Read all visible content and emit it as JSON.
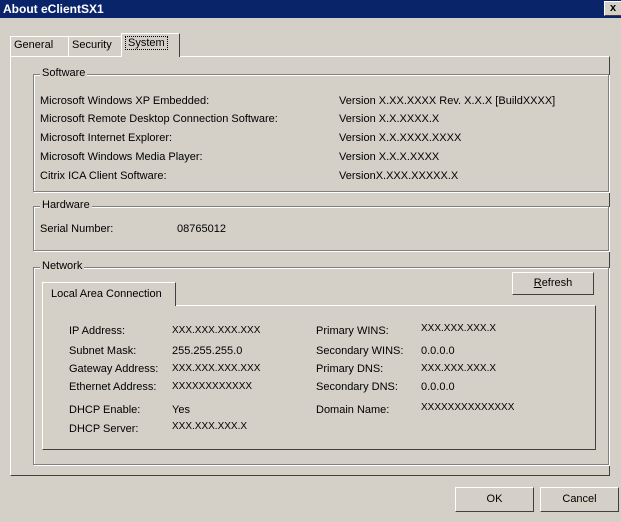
{
  "window": {
    "title": "About eClientSX1",
    "close_glyph": "x"
  },
  "tabs": [
    "General",
    "Security",
    "System"
  ],
  "software": {
    "title": "Software",
    "rows": [
      {
        "label": "Microsoft Windows XP Embedded:",
        "value": "Version X.XX.XXXX Rev. X.X.X [BuildXXXX]"
      },
      {
        "label": "Microsoft Remote Desktop Connection Software:",
        "value": "Version X.X.XXXX.X"
      },
      {
        "label": "Microsoft Internet Explorer:",
        "value": "Version X.X.XXXX.XXXX"
      },
      {
        "label": "Microsoft Windows Media Player:",
        "value": "Version X.X.X.XXXX"
      },
      {
        "label": "Citrix ICA Client Software:",
        "value": "VersionX.XXX.XXXXX.X"
      }
    ]
  },
  "hardware": {
    "title": "Hardware",
    "serial_label": "Serial Number:",
    "serial_value": "08765012"
  },
  "network": {
    "title": "Network",
    "subtab": "Local Area Connection",
    "refresh_label_prefix": "",
    "refresh_accel": "R",
    "refresh_label_rest": "efresh",
    "left": [
      {
        "label": "IP Address:",
        "value": "XXX.XXX.XXX.XXX"
      },
      {
        "label": "Subnet Mask:",
        "value": "255.255.255.0"
      },
      {
        "label": "Gateway Address:",
        "value": "XXX.XXX.XXX.XXX"
      },
      {
        "label": "Ethernet Address:",
        "value": "XXXXXXXXXXXX"
      },
      {
        "label": "DHCP Enable:",
        "value": "Yes"
      },
      {
        "label": "DHCP Server:",
        "value": "XXX.XXX.XXX.X"
      }
    ],
    "right": [
      {
        "label": "Primary WINS:",
        "value": "XXX.XXX.XXX.X"
      },
      {
        "label": "Secondary WINS:",
        "value": "0.0.0.0"
      },
      {
        "label": "Primary DNS:",
        "value": "XXX.XXX.XXX.X"
      },
      {
        "label": "Secondary DNS:",
        "value": "0.0.0.0"
      },
      {
        "label": "Domain Name:",
        "value": "XXXXXXXXXXXXXX"
      }
    ]
  },
  "buttons": {
    "ok": "OK",
    "cancel": "Cancel"
  }
}
